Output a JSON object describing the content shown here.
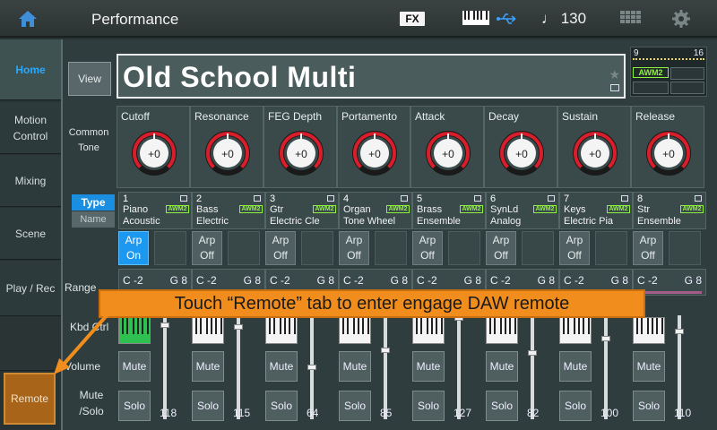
{
  "header": {
    "title": "Performance",
    "fx_label": "FX",
    "tempo": "♩ 130"
  },
  "nav": {
    "items": [
      {
        "label": "Home"
      },
      {
        "label": "Motion Control"
      },
      {
        "label": "Mixing"
      },
      {
        "label": "Scene"
      },
      {
        "label": "Play / Rec"
      },
      {
        "label": "Remote"
      }
    ]
  },
  "performance": {
    "view_label": "View",
    "name": "Old School Multi"
  },
  "part_indicator": {
    "lo": "9",
    "hi": "16",
    "awm": "AWM2"
  },
  "common_tone": {
    "label": "Common Tone",
    "knobs": [
      {
        "label": "Cutoff",
        "value": "+0"
      },
      {
        "label": "Resonance",
        "value": "+0"
      },
      {
        "label": "FEG Depth",
        "value": "+0"
      },
      {
        "label": "Portamento",
        "value": "+0"
      },
      {
        "label": "Attack",
        "value": "+0"
      },
      {
        "label": "Decay",
        "value": "+0"
      },
      {
        "label": "Sustain",
        "value": "+0"
      },
      {
        "label": "Release",
        "value": "+0"
      }
    ]
  },
  "view_mode": {
    "type_label": "Type",
    "name_label": "Name"
  },
  "rows": {
    "range": "Range",
    "kbd_ctrl": "Kbd Ctrl",
    "volume": "Volume",
    "mute_solo": "Mute /Solo"
  },
  "parts": [
    {
      "num": "1",
      "line1": "Piano",
      "line2": "Acoustic",
      "awm": "AWM2",
      "arp": "Arp\nOn",
      "arp_on": true,
      "range_lo": "C -2",
      "range_hi": "G 8",
      "volume": "118",
      "mute": "Mute",
      "solo": "Solo"
    },
    {
      "num": "2",
      "line1": "Bass",
      "line2": "Electric",
      "awm": "AWM2",
      "arp": "Arp\nOff",
      "arp_on": false,
      "range_lo": "C -2",
      "range_hi": "G 8",
      "volume": "115",
      "mute": "Mute",
      "solo": "Solo"
    },
    {
      "num": "3",
      "line1": "Gtr",
      "line2": "Electric Cle",
      "awm": "AWM2",
      "arp": "Arp\nOff",
      "arp_on": false,
      "range_lo": "C -2",
      "range_hi": "G 8",
      "volume": "64",
      "mute": "Mute",
      "solo": "Solo"
    },
    {
      "num": "4",
      "line1": "Organ",
      "line2": "Tone Wheel",
      "awm": "AWM2",
      "arp": "Arp\nOff",
      "arp_on": false,
      "range_lo": "C -2",
      "range_hi": "G 8",
      "volume": "85",
      "mute": "Mute",
      "solo": "Solo"
    },
    {
      "num": "5",
      "line1": "Brass",
      "line2": "Ensemble",
      "awm": "AWM2",
      "arp": "Arp\nOff",
      "arp_on": false,
      "range_lo": "C -2",
      "range_hi": "G 8",
      "volume": "127",
      "mute": "Mute",
      "solo": "Solo"
    },
    {
      "num": "6",
      "line1": "SynLd",
      "line2": "Analog",
      "awm": "AWM2",
      "arp": "Arp\nOff",
      "arp_on": false,
      "range_lo": "C -2",
      "range_hi": "G 8",
      "volume": "82",
      "mute": "Mute",
      "solo": "Solo"
    },
    {
      "num": "7",
      "line1": "Keys",
      "line2": "Electric Pia",
      "awm": "AWM2",
      "arp": "Arp\nOff",
      "arp_on": false,
      "range_lo": "C -2",
      "range_hi": "G 8",
      "volume": "100",
      "mute": "Mute",
      "solo": "Solo"
    },
    {
      "num": "8",
      "line1": "Str",
      "line2": "Ensemble",
      "awm": "AWM2",
      "arp": "Arp\nOff",
      "arp_on": false,
      "range_lo": "C -2",
      "range_hi": "G 8",
      "volume": "110",
      "mute": "Mute",
      "solo": "Solo"
    }
  ],
  "callout": {
    "text": "Touch “Remote” tab to enter engage DAW remote"
  },
  "colors": {
    "accent_blue": "#1c98f0",
    "awm_green": "#90f040",
    "remote_orange": "#a86418",
    "callout_orange": "#f08d1c"
  }
}
